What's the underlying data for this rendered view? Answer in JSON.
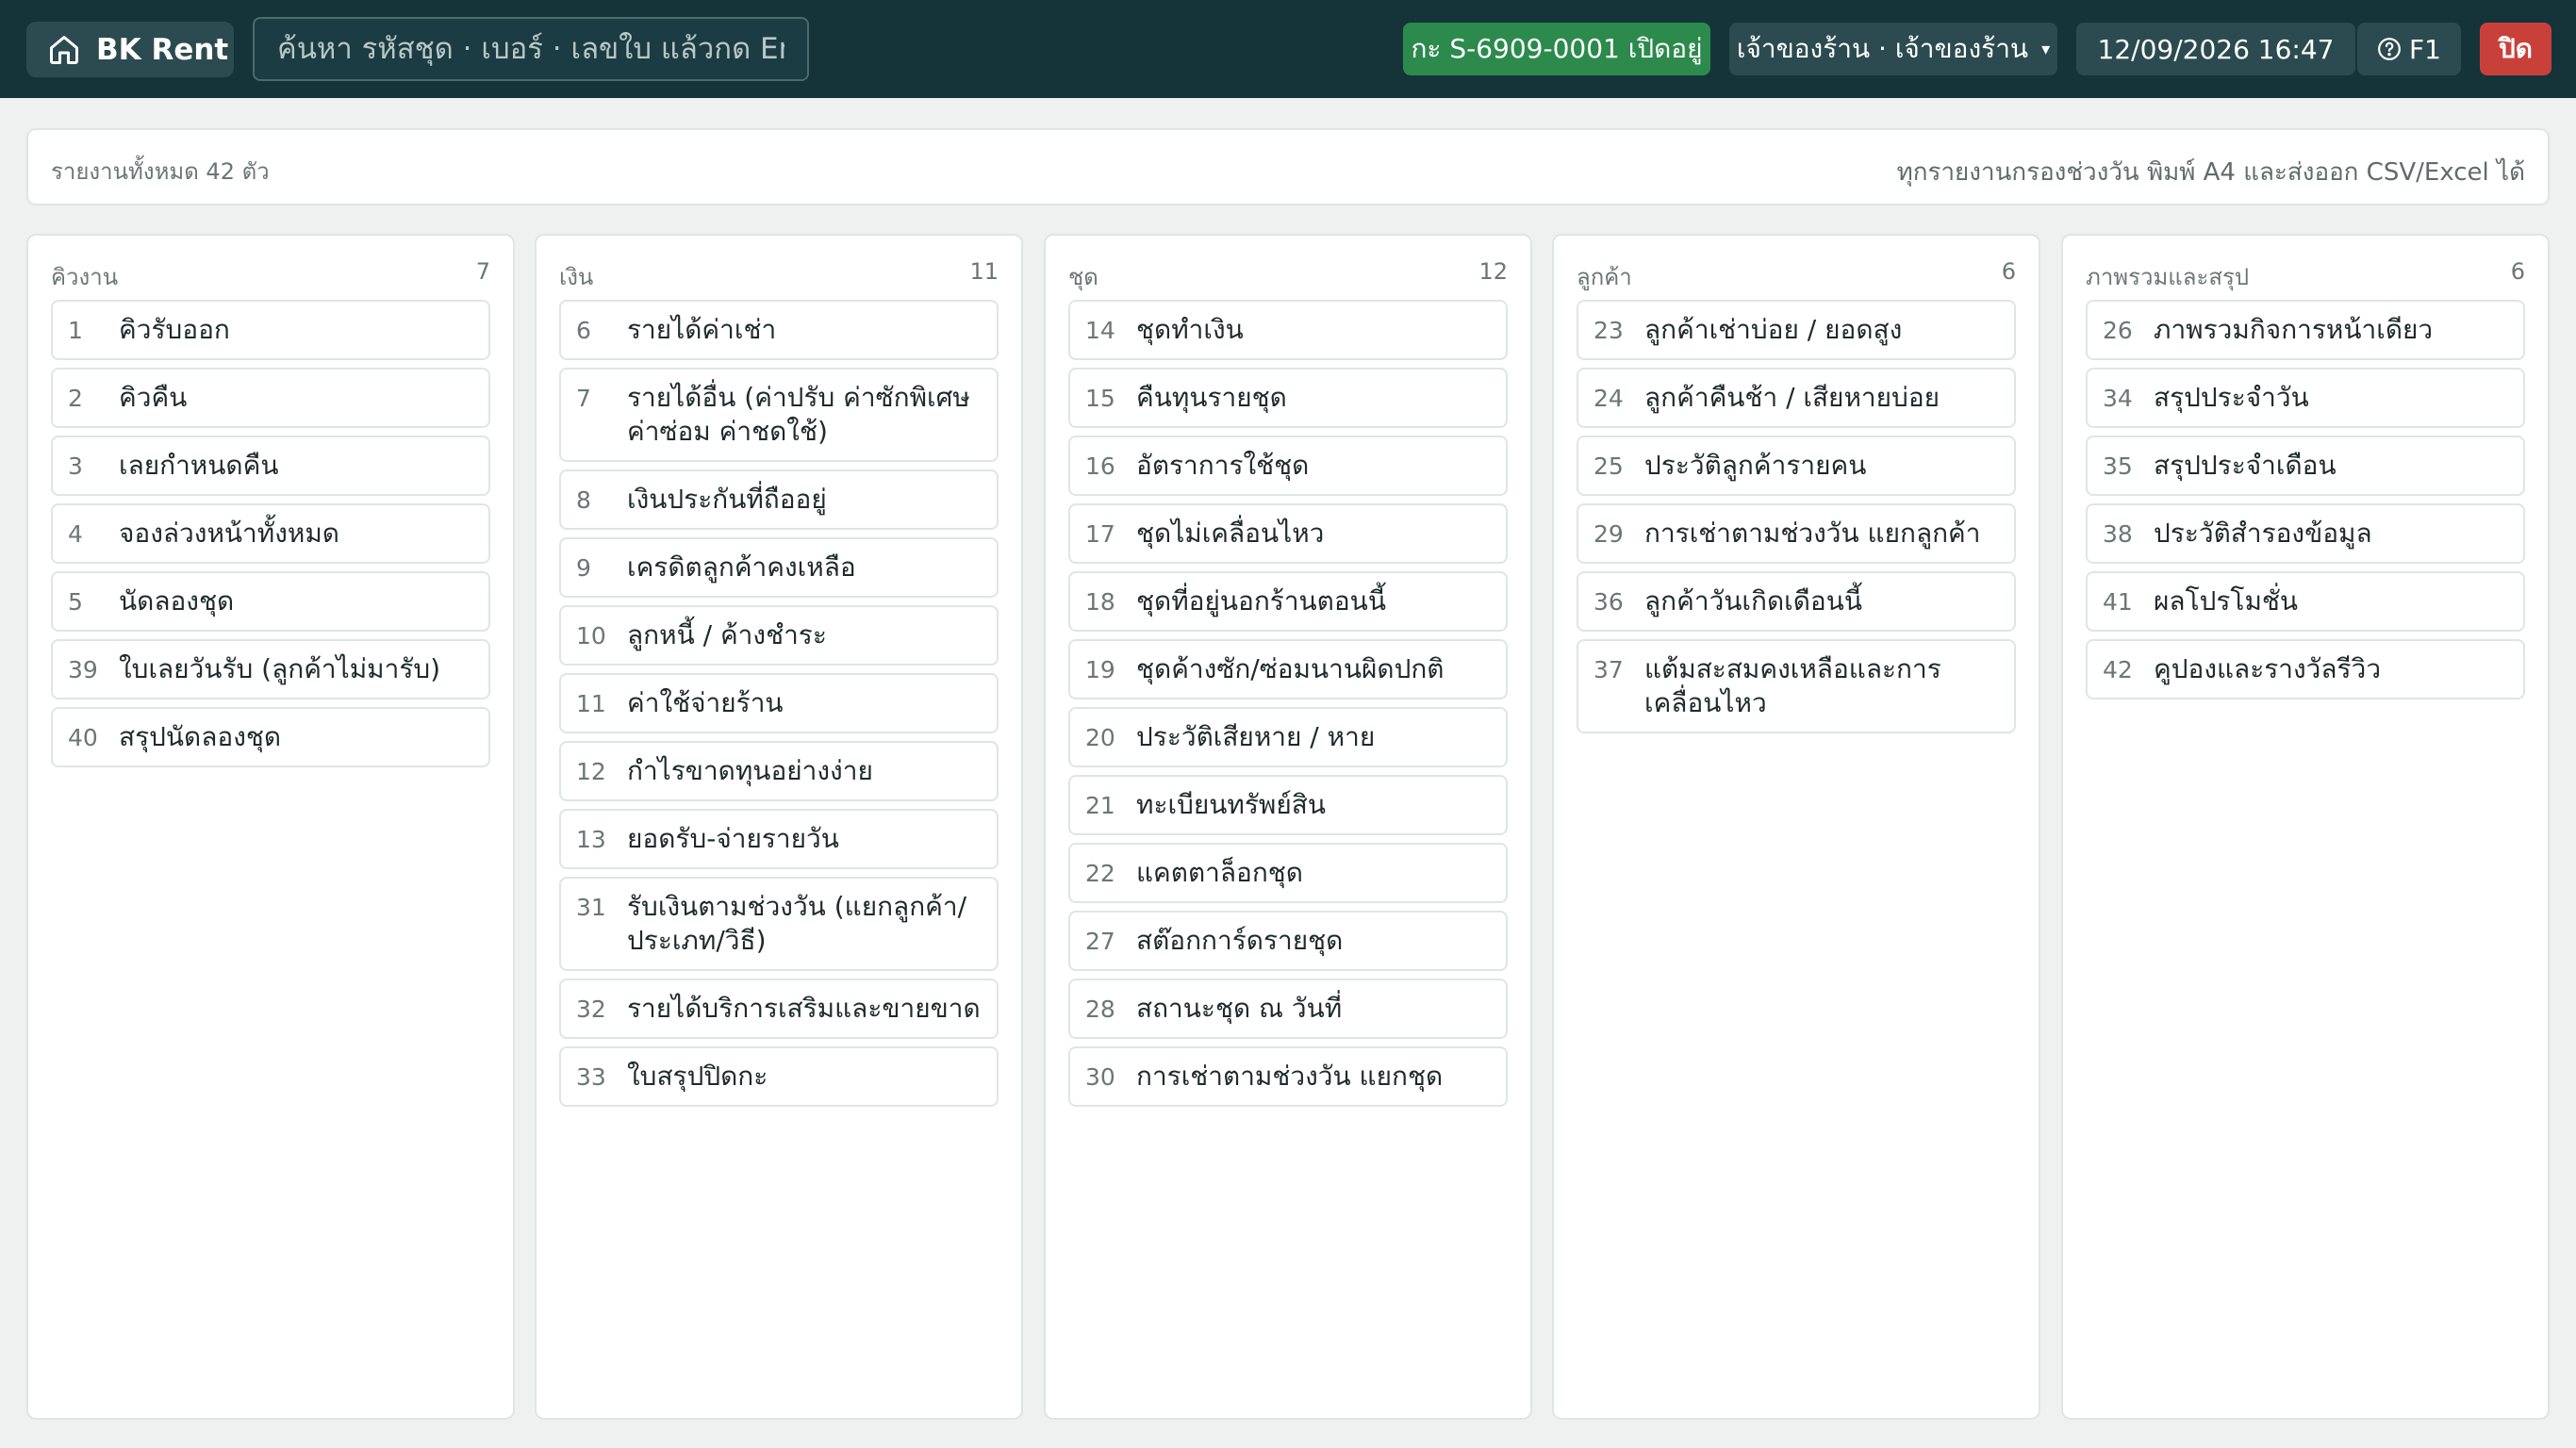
{
  "header": {
    "brand": "BK Rent",
    "search_placeholder": "ค้นหา รหัสชุด · เบอร์ · เลขใบ แล้วกด En...",
    "shift_badge": "กะ S-6909-0001 เปิดอยู่",
    "user": "เจ้าของร้าน · เจ้าของร้าน",
    "user_caret": "▾",
    "datetime": "12/09/2026 16:47",
    "help": "F1",
    "close": "ปิด"
  },
  "info": {
    "left": "รายงานทั้งหมด 42 ตัว",
    "right": "ทุกรายงานกรองช่วงวัน พิมพ์ A4 และส่งออก CSV/Excel ได้"
  },
  "columns": [
    {
      "title": "คิวงาน",
      "count": "7",
      "items": [
        {
          "num": "1",
          "label": "คิวรับออก"
        },
        {
          "num": "2",
          "label": "คิวคืน"
        },
        {
          "num": "3",
          "label": "เลยกำหนดคืน"
        },
        {
          "num": "4",
          "label": "จองล่วงหน้าทั้งหมด"
        },
        {
          "num": "5",
          "label": "นัดลองชุด"
        },
        {
          "num": "39",
          "label": "ใบเลยวันรับ (ลูกค้าไม่มารับ)"
        },
        {
          "num": "40",
          "label": "สรุปนัดลองชุด"
        }
      ]
    },
    {
      "title": "เงิน",
      "count": "11",
      "items": [
        {
          "num": "6",
          "label": "รายได้ค่าเช่า"
        },
        {
          "num": "7",
          "label": "รายได้อื่น (ค่าปรับ ค่าซักพิเศษ ค่าซ่อม ค่าชดใช้)"
        },
        {
          "num": "8",
          "label": "เงินประกันที่ถืออยู่"
        },
        {
          "num": "9",
          "label": "เครดิตลูกค้าคงเหลือ"
        },
        {
          "num": "10",
          "label": "ลูกหนี้ / ค้างชำระ"
        },
        {
          "num": "11",
          "label": "ค่าใช้จ่ายร้าน"
        },
        {
          "num": "12",
          "label": "กำไรขาดทุนอย่างง่าย"
        },
        {
          "num": "13",
          "label": "ยอดรับ-จ่ายรายวัน"
        },
        {
          "num": "31",
          "label": "รับเงินตามช่วงวัน (แยกลูกค้า/ประเภท/วิธี)"
        },
        {
          "num": "32",
          "label": "รายได้บริการเสริมและขายขาด"
        },
        {
          "num": "33",
          "label": "ใบสรุปปิดกะ"
        }
      ]
    },
    {
      "title": "ชุด",
      "count": "12",
      "items": [
        {
          "num": "14",
          "label": "ชุดทำเงิน"
        },
        {
          "num": "15",
          "label": "คืนทุนรายชุด"
        },
        {
          "num": "16",
          "label": "อัตราการใช้ชุด"
        },
        {
          "num": "17",
          "label": "ชุดไม่เคลื่อนไหว"
        },
        {
          "num": "18",
          "label": "ชุดที่อยู่นอกร้านตอนนี้"
        },
        {
          "num": "19",
          "label": "ชุดค้างซัก/ซ่อมนานผิดปกติ"
        },
        {
          "num": "20",
          "label": "ประวัติเสียหาย / หาย"
        },
        {
          "num": "21",
          "label": "ทะเบียนทรัพย์สิน"
        },
        {
          "num": "22",
          "label": "แคตตาล็อกชุด"
        },
        {
          "num": "27",
          "label": "สต๊อกการ์ดรายชุด"
        },
        {
          "num": "28",
          "label": "สถานะชุด ณ วันที่"
        },
        {
          "num": "30",
          "label": "การเช่าตามช่วงวัน แยกชุด"
        }
      ]
    },
    {
      "title": "ลูกค้า",
      "count": "6",
      "items": [
        {
          "num": "23",
          "label": "ลูกค้าเช่าบ่อย / ยอดสูง"
        },
        {
          "num": "24",
          "label": "ลูกค้าคืนช้า / เสียหายบ่อย"
        },
        {
          "num": "25",
          "label": "ประวัติลูกค้ารายคน"
        },
        {
          "num": "29",
          "label": "การเช่าตามช่วงวัน แยกลูกค้า"
        },
        {
          "num": "36",
          "label": "ลูกค้าวันเกิดเดือนนี้"
        },
        {
          "num": "37",
          "label": "แต้มสะสมคงเหลือและการเคลื่อนไหว"
        }
      ]
    },
    {
      "title": "ภาพรวมและสรุป",
      "count": "6",
      "items": [
        {
          "num": "26",
          "label": "ภาพรวมกิจการหน้าเดียว"
        },
        {
          "num": "34",
          "label": "สรุปประจำวัน"
        },
        {
          "num": "35",
          "label": "สรุปประจำเดือน"
        },
        {
          "num": "38",
          "label": "ประวัติสำรองข้อมูล"
        },
        {
          "num": "41",
          "label": "ผลโปรโมชั่น"
        },
        {
          "num": "42",
          "label": "คูปองและรางวัลรีวิว"
        }
      ]
    }
  ]
}
